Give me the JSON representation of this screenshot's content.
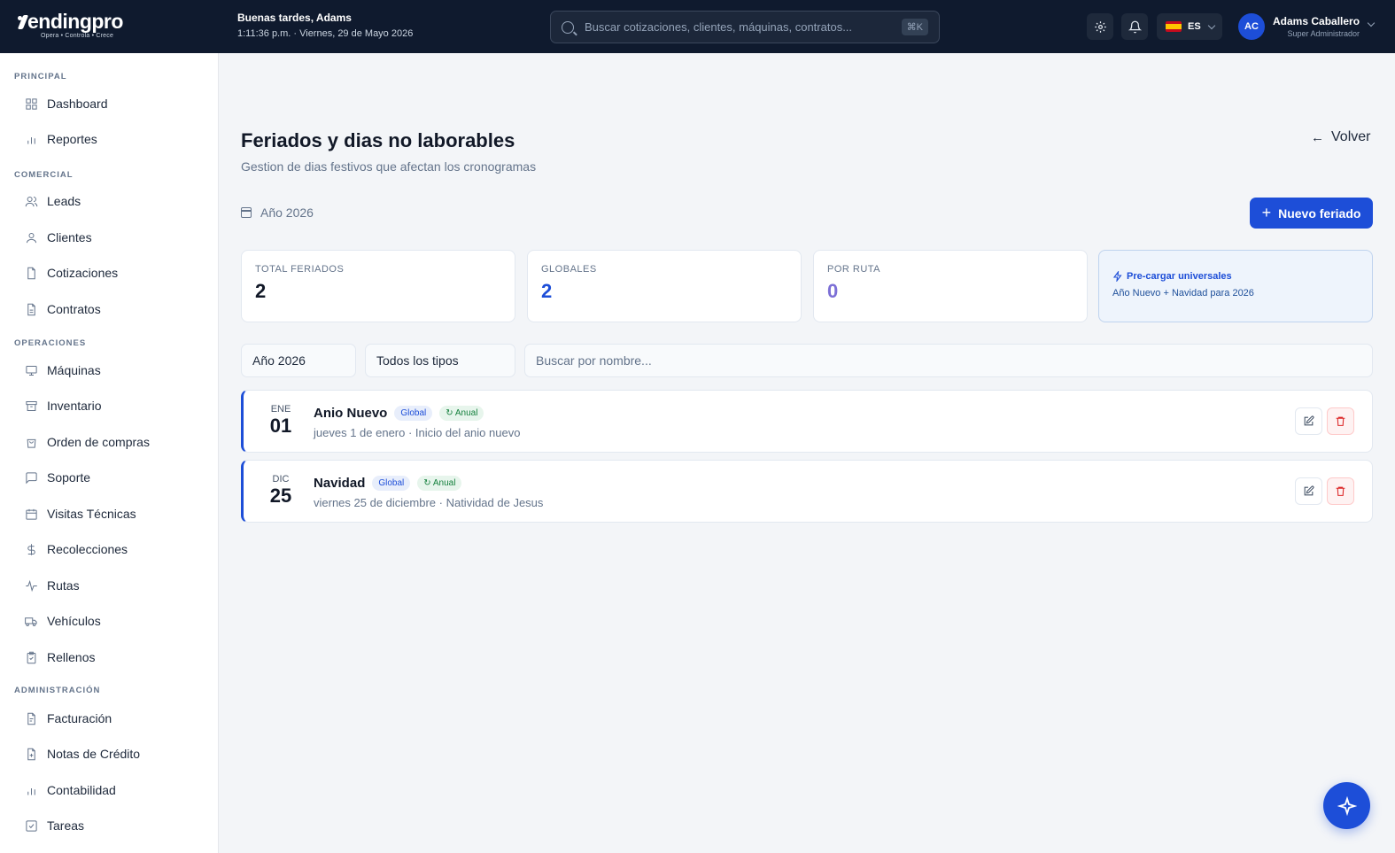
{
  "brand": {
    "name": "endingpro",
    "tagline": "Opera • Controla • Crece"
  },
  "header": {
    "greeting": "Buenas tardes, Adams",
    "datetime": "1:11:36 p.m. · Viernes, 29 de Mayo 2026",
    "search_placeholder": "Buscar cotizaciones, clientes, máquinas, contratos...",
    "search_shortcut": "⌘K",
    "language": "ES",
    "user": {
      "initials": "AC",
      "name": "Adams Caballero",
      "role": "Super Administrador"
    }
  },
  "sidebar": {
    "sections": [
      {
        "title": "PRINCIPAL",
        "items": [
          {
            "label": "Dashboard",
            "icon": "grid-icon"
          },
          {
            "label": "Reportes",
            "icon": "bar-chart-icon"
          }
        ]
      },
      {
        "title": "COMERCIAL",
        "items": [
          {
            "label": "Leads",
            "icon": "users-icon"
          },
          {
            "label": "Clientes",
            "icon": "user-icon"
          },
          {
            "label": "Cotizaciones",
            "icon": "file-icon"
          },
          {
            "label": "Contratos",
            "icon": "file-text-icon"
          }
        ]
      },
      {
        "title": "OPERACIONES",
        "items": [
          {
            "label": "Máquinas",
            "icon": "monitor-icon"
          },
          {
            "label": "Inventario",
            "icon": "archive-icon"
          },
          {
            "label": "Orden de compras",
            "icon": "shopping-bag-icon"
          },
          {
            "label": "Soporte",
            "icon": "message-icon"
          },
          {
            "label": "Visitas Técnicas",
            "icon": "calendar-icon"
          },
          {
            "label": "Recolecciones",
            "icon": "dollar-icon"
          },
          {
            "label": "Rutas",
            "icon": "activity-icon"
          },
          {
            "label": "Vehículos",
            "icon": "truck-icon"
          },
          {
            "label": "Rellenos",
            "icon": "clipboard-icon"
          }
        ]
      },
      {
        "title": "ADMINISTRACIÓN",
        "items": [
          {
            "label": "Facturación",
            "icon": "receipt-icon"
          },
          {
            "label": "Notas de Crédito",
            "icon": "file-plus-icon"
          },
          {
            "label": "Contabilidad",
            "icon": "bar-chart-icon"
          },
          {
            "label": "Tareas",
            "icon": "check-square-icon"
          }
        ]
      }
    ]
  },
  "page": {
    "title": "Feriados y dias no laborables",
    "subtitle": "Gestion de dias festivos que afectan los cronogramas",
    "back_label": "Volver",
    "year_label": "Año 2026",
    "new_button": "Nuevo feriado"
  },
  "stats": [
    {
      "label": "TOTAL FERIADOS",
      "value": "2",
      "color": "#111827"
    },
    {
      "label": "GLOBALES",
      "value": "2",
      "color": "#1d4ed8"
    },
    {
      "label": "POR RUTA",
      "value": "0",
      "color": "#7c6fd6"
    }
  ],
  "preload": {
    "title": "Pre-cargar universales",
    "text": "Año Nuevo + Navidad para 2026"
  },
  "filters": {
    "year": "Año 2026",
    "type": "Todos los tipos",
    "search_placeholder": "Buscar por nombre..."
  },
  "holidays": [
    {
      "month": "ENE",
      "day": "01",
      "name": "Anio Nuevo",
      "scope": "Global",
      "recurrence": "↻ Anual",
      "description": "jueves 1 de enero · Inicio del anio nuevo"
    },
    {
      "month": "DIC",
      "day": "25",
      "name": "Navidad",
      "scope": "Global",
      "recurrence": "↻ Anual",
      "description": "viernes 25 de diciembre · Natividad de Jesus"
    }
  ],
  "colors": {
    "accent": "#1d4ed8",
    "topbar": "#0f1a2e",
    "danger": "#dc2626",
    "success": "#15803d"
  }
}
